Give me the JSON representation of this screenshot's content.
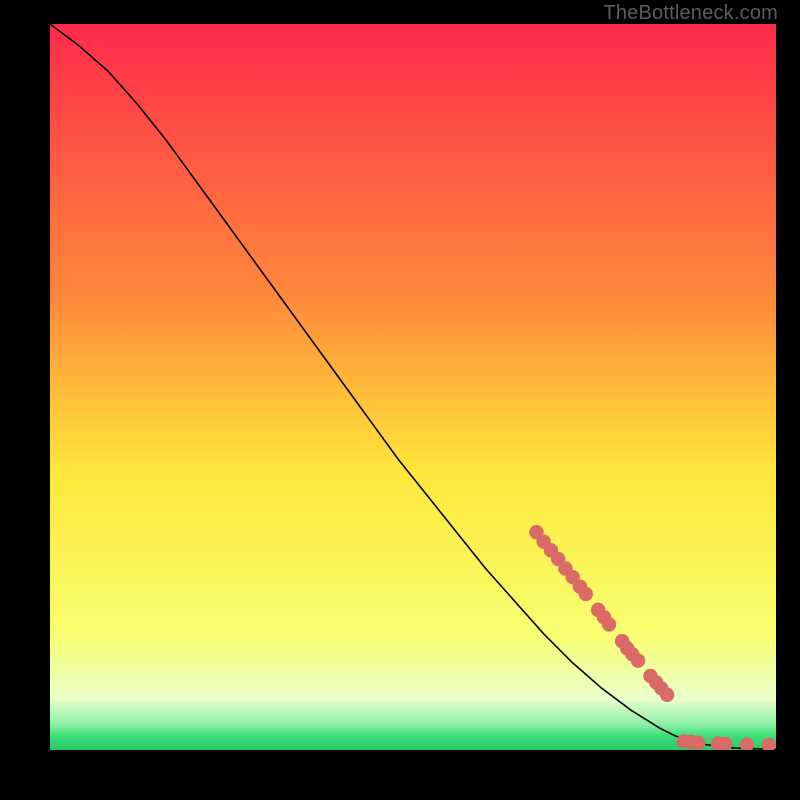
{
  "watermark": "TheBottleneck.com",
  "colors": {
    "gradient_top": "#ff2a4b",
    "gradient_mid_upper": "#ff8a3a",
    "gradient_mid": "#ffe83a",
    "gradient_lower": "#f7ff70",
    "gradient_green": "#3fe07a",
    "line": "#000000",
    "marker": "#d96a66",
    "frame": "#000000"
  },
  "chart_data": {
    "type": "line",
    "title": "",
    "xlabel": "",
    "ylabel": "",
    "xlim": [
      0,
      100
    ],
    "ylim": [
      0,
      100
    ],
    "series": [
      {
        "name": "curve",
        "x": [
          0,
          4,
          8,
          12,
          16,
          20,
          24,
          28,
          32,
          36,
          40,
          44,
          48,
          52,
          56,
          60,
          64,
          68,
          72,
          76,
          80,
          84,
          86,
          88,
          90,
          92,
          94,
          96,
          98,
          100
        ],
        "y": [
          100,
          97,
          93.5,
          89,
          84,
          78.5,
          73,
          67.5,
          62,
          56.5,
          51,
          45.5,
          40,
          35,
          30,
          25,
          20.5,
          16,
          12,
          8.5,
          5.5,
          3,
          2,
          1.3,
          0.8,
          0.5,
          0.3,
          0.2,
          0.15,
          0.1
        ]
      }
    ],
    "markers": [
      {
        "x": 67,
        "y": 30
      },
      {
        "x": 68,
        "y": 28.7
      },
      {
        "x": 69,
        "y": 27.5
      },
      {
        "x": 70,
        "y": 26.3
      },
      {
        "x": 71,
        "y": 25
      },
      {
        "x": 72,
        "y": 23.8
      },
      {
        "x": 73,
        "y": 22.5
      },
      {
        "x": 73.8,
        "y": 21.5
      },
      {
        "x": 75.5,
        "y": 19.3
      },
      {
        "x": 76.3,
        "y": 18.3
      },
      {
        "x": 77,
        "y": 17.3
      },
      {
        "x": 78.8,
        "y": 15
      },
      {
        "x": 79.5,
        "y": 14
      },
      {
        "x": 80.2,
        "y": 13.2
      },
      {
        "x": 81,
        "y": 12.3
      },
      {
        "x": 82.7,
        "y": 10.2
      },
      {
        "x": 83.5,
        "y": 9.3
      },
      {
        "x": 84.2,
        "y": 8.5
      },
      {
        "x": 85,
        "y": 7.6
      },
      {
        "x": 87.3,
        "y": 1.2
      },
      {
        "x": 88.3,
        "y": 1.1
      },
      {
        "x": 89.3,
        "y": 1.0
      },
      {
        "x": 92,
        "y": 0.9
      },
      {
        "x": 93,
        "y": 0.85
      },
      {
        "x": 96,
        "y": 0.75
      },
      {
        "x": 99,
        "y": 0.7
      }
    ]
  }
}
